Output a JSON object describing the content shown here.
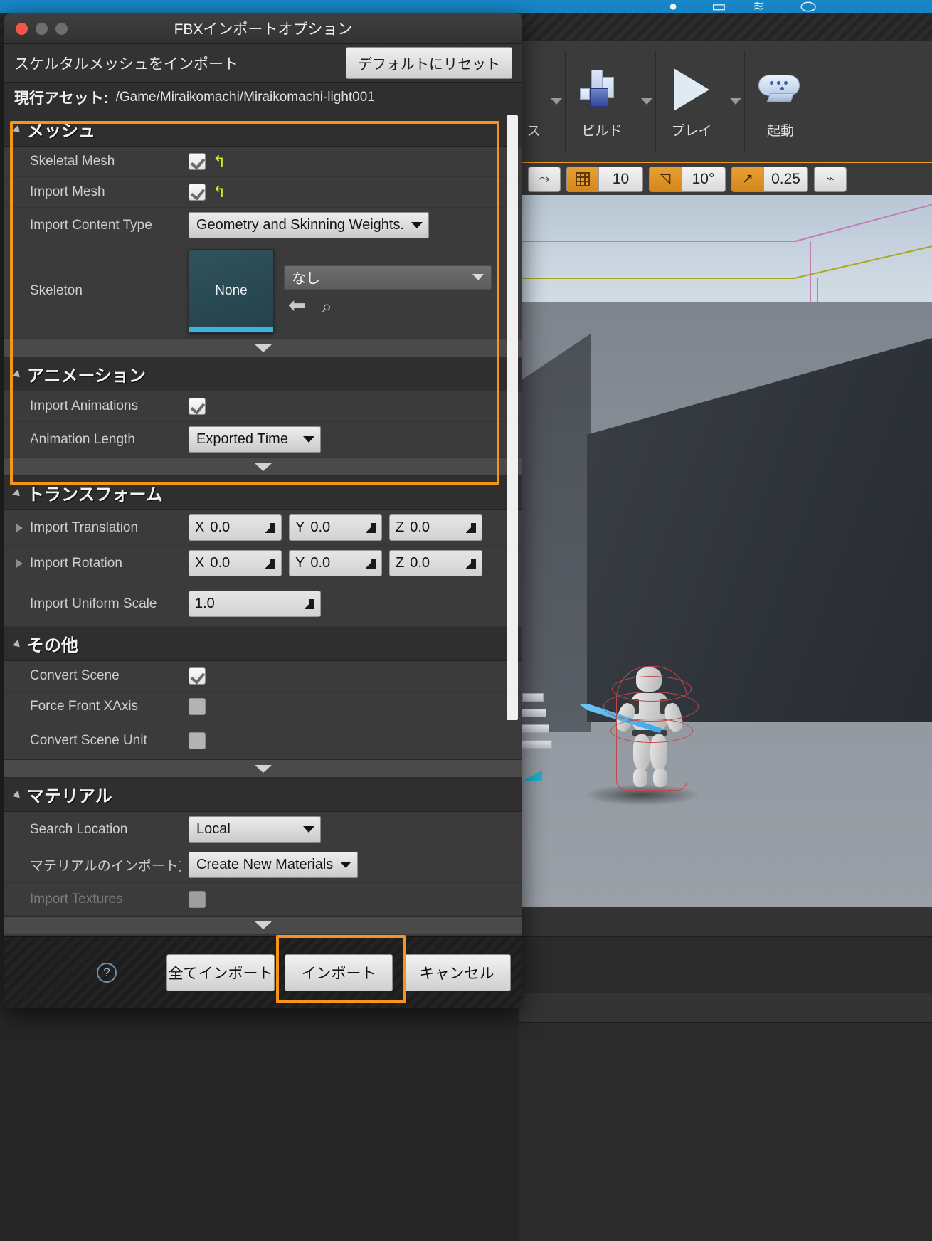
{
  "background": {
    "menubar_icons": [
      "record-dot-icon",
      "display-icon",
      "wifi-icon",
      "user-account-icon"
    ],
    "toolbar": {
      "items": [
        {
          "label": "ス",
          "icon": "settings-icon",
          "has_caret": true
        },
        {
          "label": "ビルド",
          "icon": "build-icon",
          "has_caret": true
        },
        {
          "label": "プレイ",
          "icon": "play-icon",
          "has_caret": true
        },
        {
          "label": "起動",
          "icon": "launch-gamepad-icon",
          "has_caret": false
        }
      ]
    },
    "viewport_bar": {
      "snap_groups": [
        {
          "toggle_icon": "surface-snap-icon",
          "toggle_on": false,
          "value": ""
        },
        {
          "toggle_icon": "grid-snap-icon",
          "toggle_on": true,
          "value": "10"
        },
        {
          "toggle_icon": "rotation-snap-icon",
          "toggle_on": true,
          "value": "10°"
        },
        {
          "toggle_icon": "scale-snap-icon",
          "toggle_on": true,
          "value": "0.25"
        },
        {
          "toggle_icon": "camera-speed-icon",
          "toggle_on": false,
          "value": ""
        }
      ]
    }
  },
  "dialog": {
    "title": "FBXインポートオプション",
    "traffic_lights": [
      "close",
      "minimize",
      "maximize"
    ],
    "subhead": {
      "label": "スケルタルメッシュをインポート",
      "reset_button": "デフォルトにリセット"
    },
    "asset_bar": {
      "key": "現行アセット:",
      "value": "/Game/Miraikomachi/Miraikomachi-light001"
    },
    "sections": [
      {
        "name": "mesh",
        "title": "メッシュ",
        "highlighted": true,
        "rows": [
          {
            "name": "Skeletal Mesh",
            "type": "checkbox",
            "checked": true,
            "reset": true
          },
          {
            "name": "Import Mesh",
            "type": "checkbox",
            "checked": true,
            "reset": true
          },
          {
            "name": "Import Content Type",
            "type": "combo",
            "value": "Geometry and Skinning Weights."
          },
          {
            "name": "Skeleton",
            "type": "asset_picker",
            "thumbnail_caption": "None",
            "select_value": "なし",
            "actions": [
              "back-arrow-icon",
              "browse-search-icon"
            ]
          }
        ]
      },
      {
        "name": "animation",
        "title": "アニメーション",
        "highlighted": true,
        "rows": [
          {
            "name": "Import Animations",
            "type": "checkbox",
            "checked": true
          },
          {
            "name": "Animation Length",
            "type": "combo",
            "value": "Exported Time"
          }
        ]
      },
      {
        "name": "transform",
        "title": "トランスフォーム",
        "highlighted": false,
        "rows": [
          {
            "name": "Import Translation",
            "type": "vector3",
            "expandable": true,
            "axes": [
              "X",
              "Y",
              "Z"
            ],
            "values": [
              "0.0",
              "0.0",
              "0.0"
            ]
          },
          {
            "name": "Import Rotation",
            "type": "vector3",
            "expandable": true,
            "axes": [
              "X",
              "Y",
              "Z"
            ],
            "values": [
              "0.0",
              "0.0",
              "0.0"
            ]
          },
          {
            "name": "Import Uniform Scale",
            "type": "number",
            "value": "1.0"
          }
        ]
      },
      {
        "name": "misc",
        "title": "その他",
        "highlighted": false,
        "rows": [
          {
            "name": "Convert Scene",
            "type": "checkbox",
            "checked": true
          },
          {
            "name": "Force Front XAxis",
            "type": "checkbox",
            "checked": false
          },
          {
            "name": "Convert Scene Unit",
            "type": "checkbox",
            "checked": false
          }
        ]
      },
      {
        "name": "material",
        "title": "マテリアル",
        "highlighted": false,
        "rows": [
          {
            "name": "Search Location",
            "type": "combo",
            "value": "Local"
          },
          {
            "name": "マテリアルのインポート方",
            "type": "combo",
            "value": "Create New Materials"
          },
          {
            "name": "Import Textures",
            "type": "checkbox",
            "checked": true,
            "disabled": true
          }
        ]
      }
    ],
    "footer": {
      "help_icon": "help-question-icon",
      "buttons": [
        {
          "label": "全てインポート",
          "highlighted": false
        },
        {
          "label": "インポート",
          "highlighted": true
        },
        {
          "label": "キャンセル",
          "highlighted": false
        }
      ]
    }
  },
  "colors": {
    "highlight": "#f7941e",
    "dialog_bg": "#2b2b2b",
    "panel_bg": "#383838",
    "accent_blue": "#3fb4d8",
    "snap_orange": "#e8a033"
  }
}
